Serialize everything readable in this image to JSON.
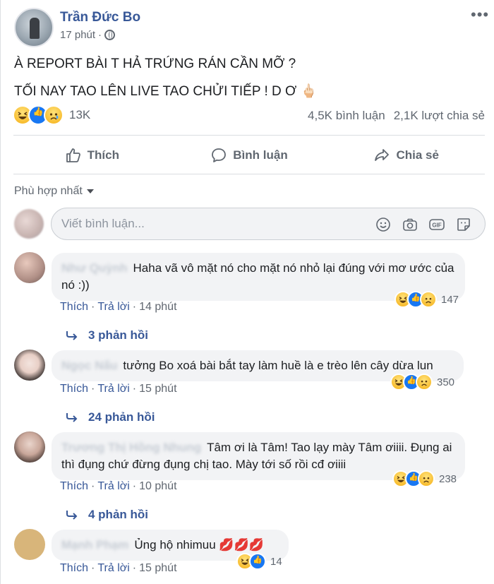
{
  "post": {
    "author": "Trần Đức Bo",
    "time": "17 phút",
    "more_label": "•••",
    "lines": [
      "À REPORT BÀI T HẢ TRỨNG RÁN CẦN MỠ ?",
      "TỐI NAY TAO LÊN LIVE TAO CHỬI TIẾP ! D Ơ 🖕🏻"
    ],
    "reaction_total": "13K",
    "comments_count": "4,5K bình luận",
    "shares_count": "2,1K lượt chia sẻ"
  },
  "actions": {
    "like": "Thích",
    "comment": "Bình luận",
    "share": "Chia sẻ"
  },
  "sort_label": "Phù hợp nhất",
  "composer": {
    "placeholder": "Viết bình luận..."
  },
  "comments": [
    {
      "name": "Như Quỳnh",
      "text": "Haha vã vô mặt nó cho mặt nó nhỏ lại đúng với mơ ước của nó :))",
      "reaction_count": "147",
      "like_label": "Thích",
      "reply_label": "Trả lời",
      "time": "14 phút",
      "replies": "3 phản hồi"
    },
    {
      "name": "Ngọc Nấu",
      "text": "tưởng Bo xoá bài bắt tay làm huề là e trèo lên cây dừa lun",
      "reaction_count": "350",
      "like_label": "Thích",
      "reply_label": "Trả lời",
      "time": "15 phút",
      "replies": "24 phản hồi"
    },
    {
      "name": "Trương Thị Hồng Nhung",
      "text": "Tâm ơi là Tâm! Tao lạy mày Tâm ơiiii. Đụng ai thì đụng chứ đừng đụng chị tao. Mày tới số rồi cđ ơiiii",
      "reaction_count": "238",
      "like_label": "Thích",
      "reply_label": "Trả lời",
      "time": "10 phút",
      "replies": "4 phản hồi"
    },
    {
      "name": "Mạnh Phạm",
      "text": "Ủng hộ nhimuu 💋💋💋",
      "reaction_count": "14",
      "like_label": "Thích",
      "reply_label": "Trả lời",
      "time": "15 phút"
    }
  ],
  "colors": {
    "link": "#385898",
    "secondary_text": "#606770",
    "bubble_bg": "#f2f3f5",
    "like_blue": "#1877f2",
    "haha_yellow": "#f7b928"
  }
}
